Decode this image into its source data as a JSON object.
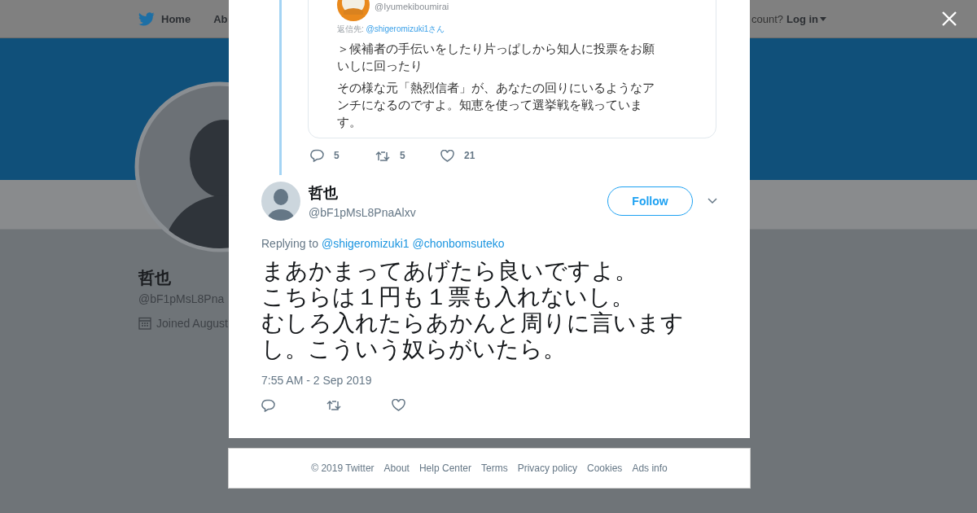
{
  "nav": {
    "items": [
      "Home",
      "Ab"
    ],
    "account_prompt": "count?",
    "login": "Log in"
  },
  "profile": {
    "name": "哲也",
    "handle": "@bF1pMsL8Pna",
    "joined": "Joined August"
  },
  "parent_tweet": {
    "quoted_screenshot": {
      "handle": "@Iyumekiboumirai",
      "reply_to_label": "返信先:",
      "reply_to": "@shigeromizuki1さん",
      "paragraphs": [
        "＞候補者の手伝いをしたり片っぱしから知人に投票をお願いしに回ったり",
        "その様な元「熱烈信者」が、あなたの回りにいるようなアンチになるのですよ。知恵を使って選挙戦を戦っています。"
      ]
    },
    "actions": [
      {
        "kind": "reply",
        "count": "5"
      },
      {
        "kind": "retweet",
        "count": "5"
      },
      {
        "kind": "like",
        "count": "21"
      }
    ]
  },
  "tweet": {
    "name": "哲也",
    "handle": "@bF1pMsL8PnaAlxv",
    "follow": "Follow",
    "replying_label": "Replying to",
    "replying_to": [
      "@shigeromizuki1",
      "@chonbomsuteko"
    ],
    "text_lines": [
      "まあかまってあげたら良いですよ。",
      "こちらは１円も１票も入れないし。",
      "むしろ入れたらあかんと周りに言います",
      "し。こういう奴らがいたら。"
    ],
    "timestamp": "7:55 AM - 2 Sep 2019",
    "actions": [
      {
        "kind": "reply"
      },
      {
        "kind": "retweet"
      },
      {
        "kind": "like"
      }
    ]
  },
  "footer": [
    "© 2019 Twitter",
    "About",
    "Help Center",
    "Terms",
    "Privacy policy",
    "Cookies",
    "Ads info"
  ]
}
